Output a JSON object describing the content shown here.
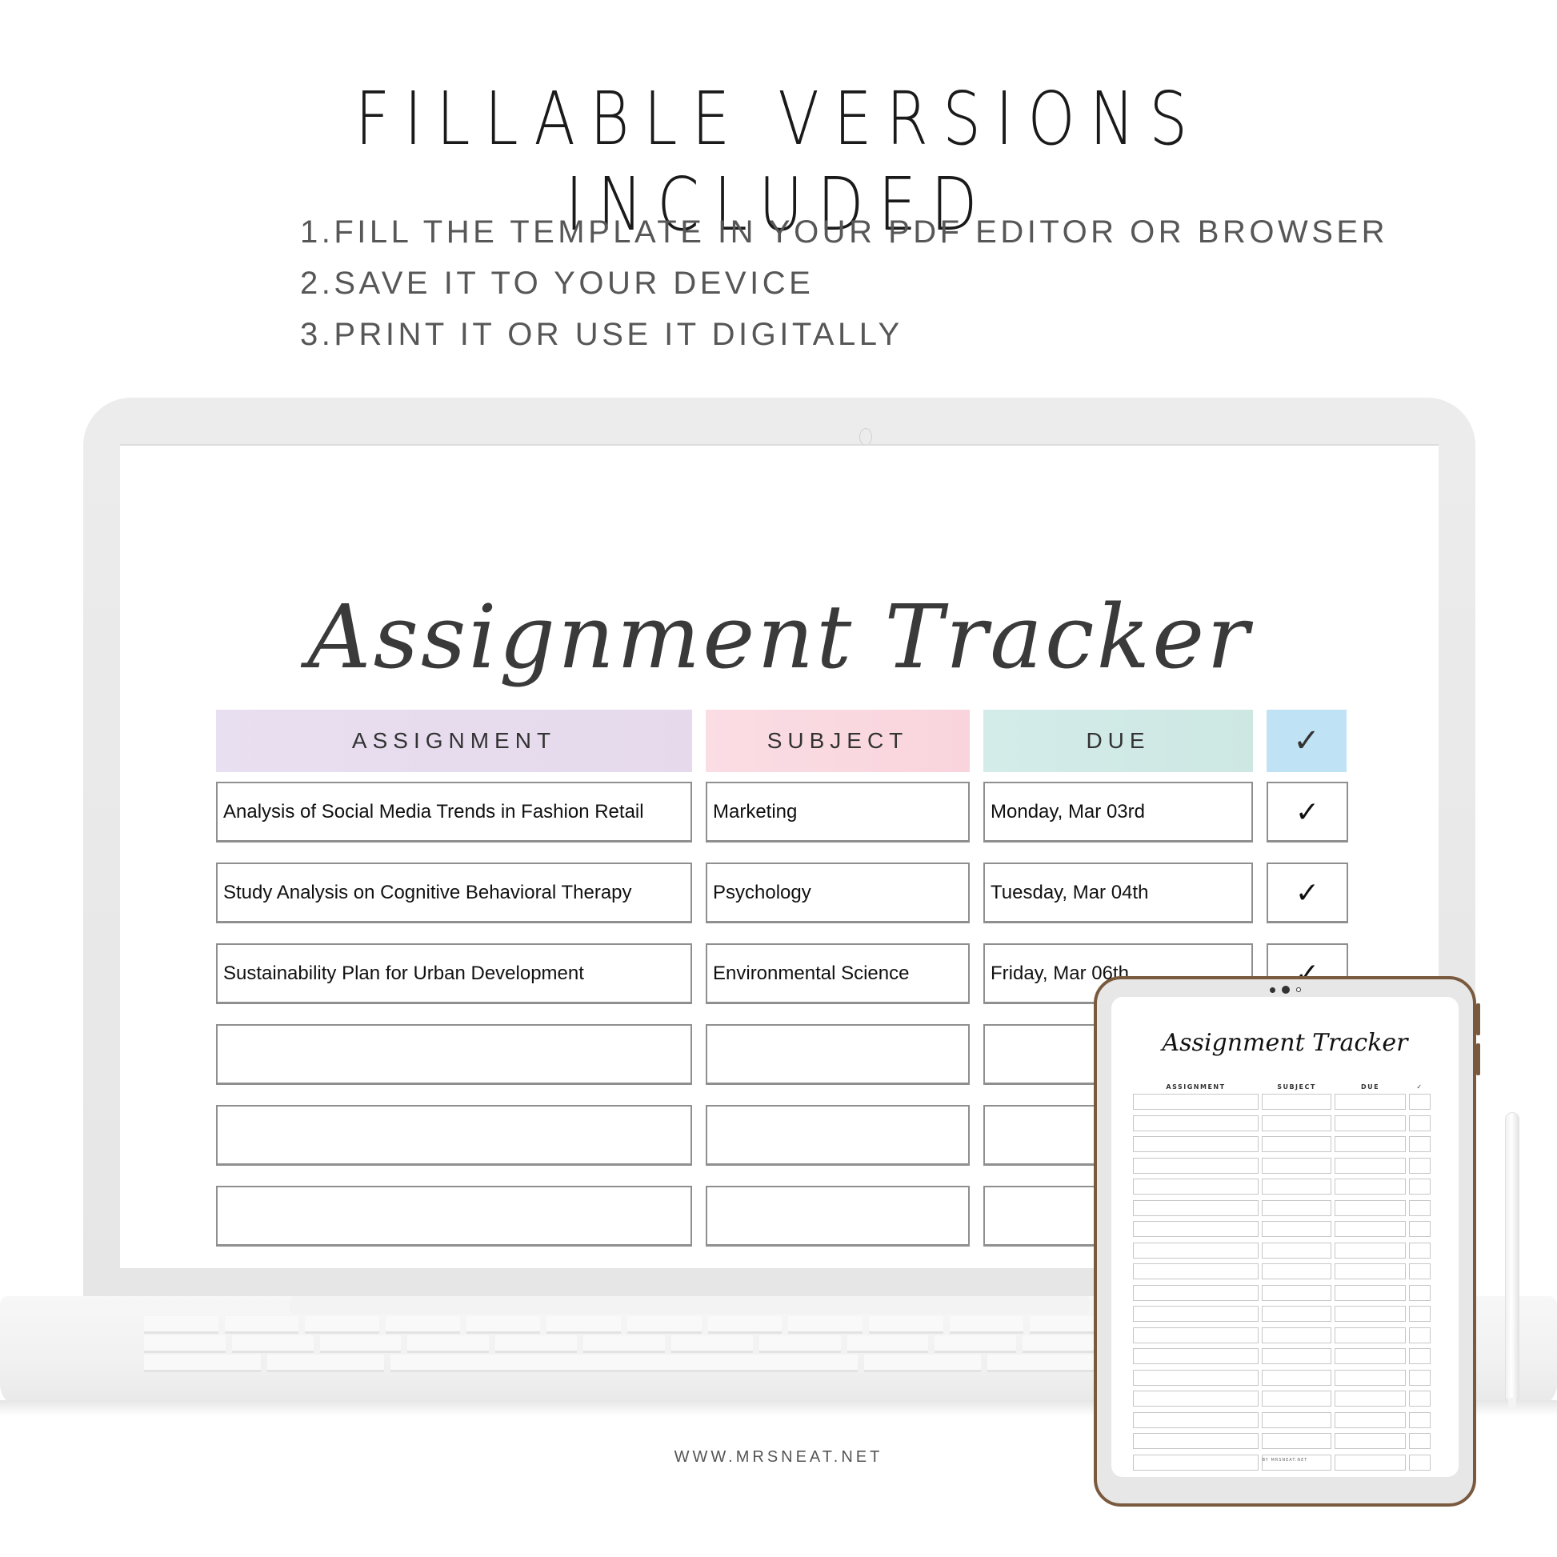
{
  "headline": "FILLABLE VERSIONS INCLUDED",
  "steps": [
    "1.FILL THE TEMPLATE IN YOUR PDF EDITOR OR BROWSER",
    "2.SAVE IT TO YOUR DEVICE",
    "3.PRINT IT OR USE IT DIGITALLY"
  ],
  "laptop": {
    "title": "Assignment Tracker",
    "columns": [
      "ASSIGNMENT",
      "SUBJECT",
      "DUE",
      "✓"
    ],
    "header_colors": {
      "assignment": "#e7dcee",
      "subject": "#fad8e0",
      "due": "#d0e9e5",
      "check": "#bfe3f4"
    },
    "rows": [
      {
        "assignment": "Analysis of Social Media Trends in Fashion Retail",
        "subject": "Marketing",
        "due": "Monday, Mar 03rd",
        "done": "✓"
      },
      {
        "assignment": "Study Analysis on Cognitive Behavioral Therapy",
        "subject": "Psychology",
        "due": "Tuesday, Mar 04th",
        "done": "✓"
      },
      {
        "assignment": "Sustainability Plan for Urban Development",
        "subject": "Environmental Science",
        "due": "Friday, Mar 06th",
        "done": "✓"
      },
      {
        "assignment": "",
        "subject": "",
        "due": "",
        "done": ""
      },
      {
        "assignment": "",
        "subject": "",
        "due": "",
        "done": ""
      },
      {
        "assignment": "",
        "subject": "",
        "due": "",
        "done": ""
      }
    ]
  },
  "tablet": {
    "title": "Assignment Tracker",
    "columns": [
      "ASSIGNMENT",
      "SUBJECT",
      "DUE",
      "✓"
    ],
    "row_count": 18,
    "footer": "BY MRSNEAT.NET",
    "frame_color": "#7a5a3e"
  },
  "footer_url": "WWW.MRSNEAT.NET"
}
